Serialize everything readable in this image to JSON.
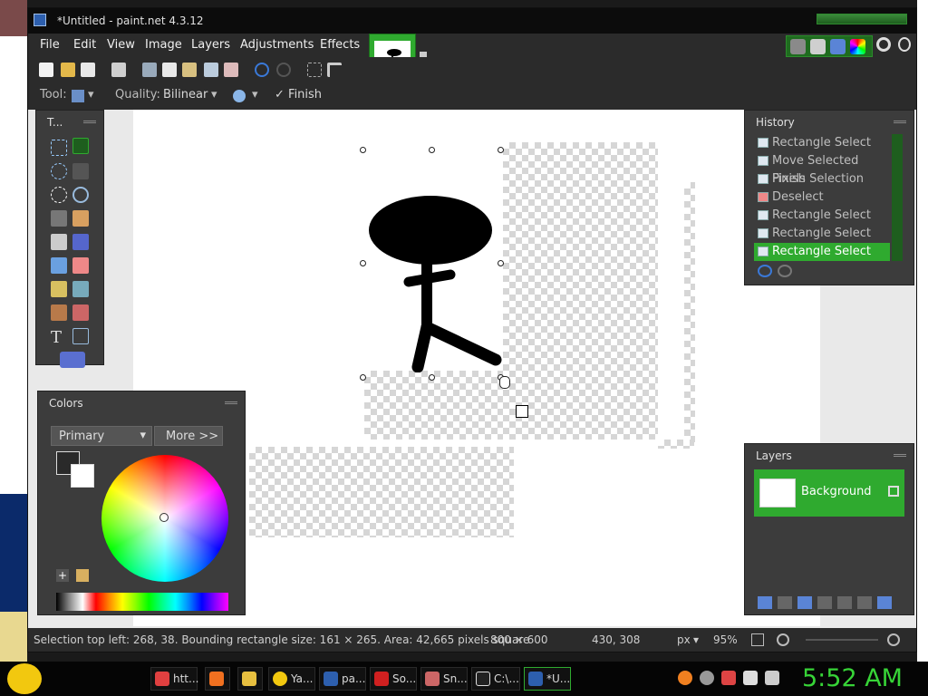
{
  "window": {
    "title": "*Untitled - paint.net 4.3.12"
  },
  "menu": [
    "File",
    "Edit",
    "View",
    "Image",
    "Layers",
    "Adjustments",
    "Effects"
  ],
  "options": {
    "tool_label": "Tool:",
    "quality_label": "Quality:",
    "quality_value": "Bilinear",
    "finish_label": "Finish"
  },
  "tools_panel": {
    "title": "T..."
  },
  "colors_panel": {
    "title": "Colors",
    "mode": "Primary",
    "more_button": "More >>"
  },
  "history_panel": {
    "title": "History",
    "items": [
      "Rectangle Select",
      "Move Selected Pixels",
      "Finish Selection",
      "Deselect",
      "Rectangle Select",
      "Rectangle Select",
      "Rectangle Select"
    ],
    "active_index": 6
  },
  "layers_panel": {
    "title": "Layers",
    "layers": [
      {
        "name": "Background"
      }
    ]
  },
  "status": {
    "selection_info": "Selection top left: 268, 38. Bounding rectangle size: 161 × 265. Area: 42,665 pixels square",
    "image_size": "800 × 600",
    "cursor_pos": "430, 308",
    "units": "px",
    "zoom": "95%"
  },
  "taskbar": {
    "buttons": [
      {
        "label": "htt...",
        "icon": "chrome-icon"
      },
      {
        "label": "",
        "icon": "firefox-icon"
      },
      {
        "label": "",
        "icon": "folder-icon"
      },
      {
        "label": "Ya...",
        "icon": "yahoo-icon"
      },
      {
        "label": "pa...",
        "icon": "paint-icon"
      },
      {
        "label": "So...",
        "icon": "app-icon"
      },
      {
        "label": "Sn...",
        "icon": "snipping-icon"
      },
      {
        "label": "C:\\...",
        "icon": "7zip-icon"
      },
      {
        "label": "*U...",
        "icon": "paint-icon"
      }
    ],
    "clock": "5:52 AM"
  },
  "colors": {
    "accent": "#2faa2f",
    "panel": "#3c3c3c",
    "clock": "#37d437"
  }
}
